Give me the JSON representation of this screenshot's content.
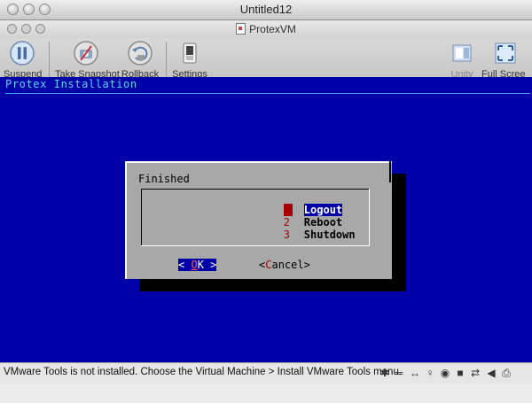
{
  "outer_window": {
    "title": "Untitled12"
  },
  "vm_window": {
    "title": "ProtexVM"
  },
  "toolbar": {
    "suspend": "Suspend",
    "take_snapshot": "Take Snapshot",
    "rollback": "Rollback",
    "settings": "Settings",
    "unity": "Unity",
    "full_screen": "Full Scree"
  },
  "console": {
    "title": "Protex Installation",
    "dialog": {
      "title": "Finished",
      "options": [
        {
          "key": "1",
          "label": "Logout",
          "selected": true
        },
        {
          "key": "2",
          "label": "Reboot",
          "selected": false
        },
        {
          "key": "3",
          "label": "Shutdown",
          "selected": false
        }
      ],
      "ok_left": "< ",
      "ok_hot": "O",
      "ok_rest": "K",
      "ok_right": " >",
      "cancel_left": "<",
      "cancel_hot": "C",
      "cancel_rest": "ancel>"
    }
  },
  "status_bar": {
    "message": "VMware Tools is not installed. Choose the Virtual Machine > Install VMware Tools menu.",
    "devices": [
      "bluetooth-icon",
      "network-icon",
      "usb-icon",
      "audio-input-icon",
      "cd-icon",
      "floppy-icon",
      "shared-folder-icon",
      "speaker-icon",
      "printer-icon"
    ]
  },
  "colors": {
    "console_bg": "#0000a8",
    "dialog_bg": "#a8a8a8",
    "highlight": "#0000a8",
    "hotkey": "#a80000"
  }
}
